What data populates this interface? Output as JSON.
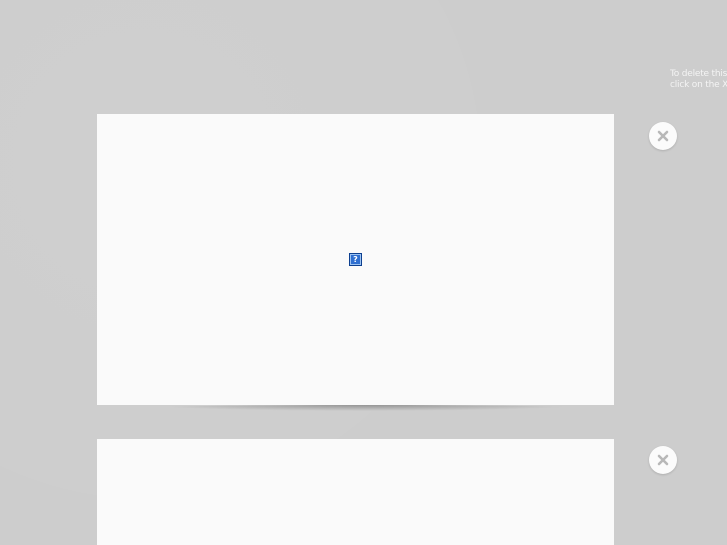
{
  "hint": {
    "line1": "To delete this",
    "line2": "click on the X"
  },
  "slides": [
    {
      "placeholder_icon": "broken-image-icon",
      "placeholder_glyph": "?",
      "delete_icon": "close-icon"
    },
    {
      "delete_icon": "close-icon"
    }
  ],
  "colors": {
    "background": "#cdcdcd",
    "slide": "#fafafa",
    "delete_glyph": "#b8b8b8",
    "placeholder": "#2f6fd0"
  }
}
